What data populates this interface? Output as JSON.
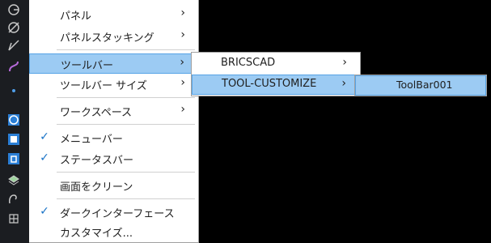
{
  "toolbar": {
    "icons": [
      "circle-target-icon",
      "circle-slash-icon",
      "line-slash-icon",
      "curve-icon",
      "point-icon",
      "shape-circle-icon",
      "shape-box-icon",
      "shape-cylinder-icon",
      "layer-icon",
      "hand-icon",
      "grid-icon"
    ]
  },
  "menu_view": {
    "items": [
      {
        "label": "パネル",
        "checked": false,
        "submenu": true
      },
      {
        "label": "パネルスタッキング",
        "checked": false,
        "submenu": true
      },
      {
        "label": "ツールバー",
        "checked": false,
        "submenu": true,
        "highlighted": true
      },
      {
        "label": "ツールバー サイズ",
        "checked": false,
        "submenu": true
      },
      {
        "label": "ワークスペース",
        "checked": false,
        "submenu": true
      },
      {
        "label": "メニューバー",
        "checked": true,
        "submenu": false
      },
      {
        "label": "ステータスバー",
        "checked": true,
        "submenu": false
      },
      {
        "label": "画面をクリーン",
        "checked": false,
        "submenu": false
      },
      {
        "label": "ダークインターフェース",
        "checked": true,
        "submenu": false
      },
      {
        "label": "カスタマイズ...",
        "checked": false,
        "submenu": false
      }
    ]
  },
  "menu_toolbars": {
    "items": [
      {
        "label": "BRICSCAD",
        "submenu": true
      },
      {
        "label": "TOOL-CUSTOMIZE",
        "submenu": true,
        "highlighted": true
      }
    ]
  },
  "menu_customize": {
    "items": [
      {
        "label": "ToolBar001"
      }
    ]
  },
  "glyphs": {
    "check": "✓",
    "arrow": "›"
  },
  "colors": {
    "highlight": "#9ccbf3",
    "highlight_border": "#57a4e6",
    "check": "#1a73c7",
    "background": "#000000"
  }
}
